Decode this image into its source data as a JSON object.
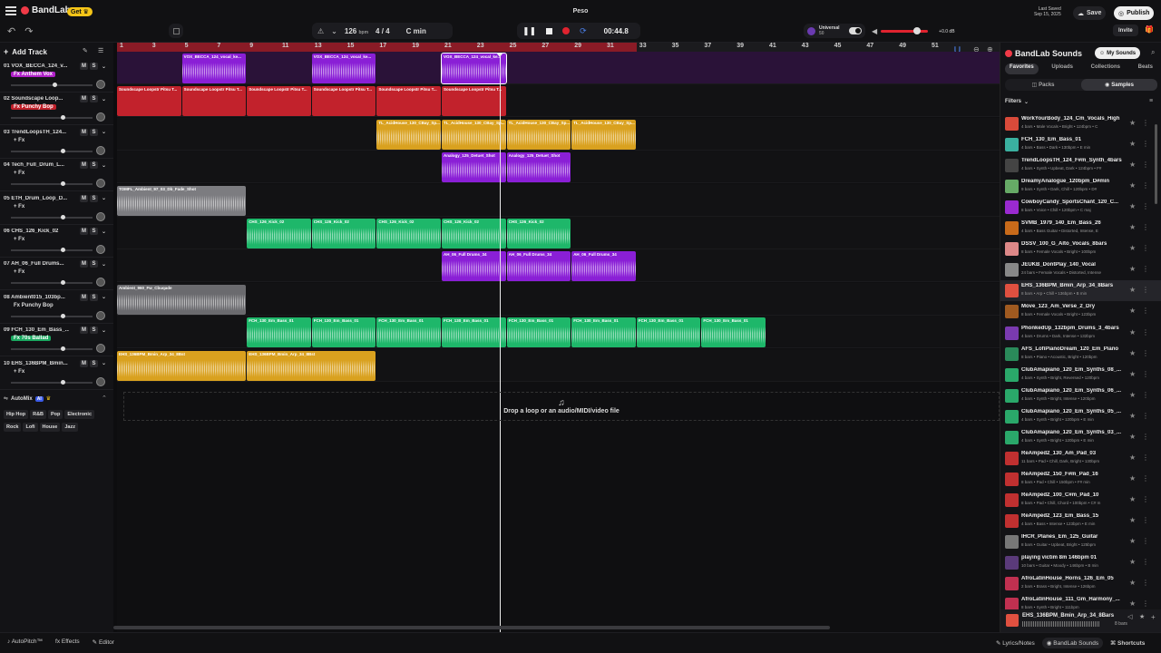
{
  "app": {
    "logo": "BandLab",
    "get_badge": "Get",
    "project_title": "Peso",
    "last_saved": "Last Saved",
    "last_saved_date": "Sep 15, 2025",
    "save": "Save",
    "publish": "Publish",
    "invite": "Invite"
  },
  "transport": {
    "bpm": "126",
    "bpm_unit": "bpm",
    "time_sig": "4 / 4",
    "key": "C min",
    "time": "00:44.8"
  },
  "master": {
    "preset": "Universal",
    "preset_sub": "50",
    "db": "+0.0 dB"
  },
  "ruler": {
    "marks": [
      "1",
      "3",
      "5",
      "7",
      "9",
      "11",
      "13",
      "15",
      "17",
      "19",
      "21",
      "23",
      "25",
      "27",
      "29",
      "31",
      "33",
      "35",
      "37",
      "39",
      "41",
      "43",
      "45",
      "47",
      "49",
      "51"
    ]
  },
  "add_track": "Add Track",
  "tracks": [
    {
      "num": "01",
      "name": "VOX_BECCA_124_v...",
      "fx": "Fx Anthem Vox",
      "fx_color": "#b020c8"
    },
    {
      "num": "02",
      "name": "Soundscape Loop...",
      "fx": "Fx Punchy Bop",
      "fx_color": "#c0202a"
    },
    {
      "num": "03",
      "name": "TrendLoopsTH_124...",
      "fx": "+ Fx",
      "fx_color": ""
    },
    {
      "num": "04",
      "name": "Tech_Full_Drum_L...",
      "fx": "+ Fx",
      "fx_color": ""
    },
    {
      "num": "05",
      "name": "ETH_Drum_Loop_D...",
      "fx": "+ Fx",
      "fx_color": ""
    },
    {
      "num": "06",
      "name": "CHS_126_Kick_02",
      "fx": "+ Fx",
      "fx_color": ""
    },
    {
      "num": "07",
      "name": "AH_06_Full Drums...",
      "fx": "+ Fx",
      "fx_color": ""
    },
    {
      "num": "08",
      "name": "Ambient015_103bp...",
      "fx": "Fx Punchy Bop",
      "fx_color": ""
    },
    {
      "num": "09",
      "name": "FCH_130_Em_Bass_...",
      "fx": "Fx 70s Ballad",
      "fx_color": "#1aa860"
    },
    {
      "num": "10",
      "name": "EHS_136BPM_Bmin...",
      "fx": "+ Fx",
      "fx_color": ""
    }
  ],
  "clips": {
    "t1": "VOX_BECCA_124_vocal_ke...",
    "t2": "Soundscape Loopstr Pitsu T...",
    "t3": "TL_AcidHouse_130_CBay_Sp...",
    "t4": "Analogy_125_Detuet_Shot",
    "t5": "TOMFL_Ambient_97_03_Db_Fade_Shot",
    "t6": "CHS_126_Kick_02",
    "t7": "AH_06_Full Drums_34",
    "t8": "Ambient_960_Fw_Cbuqade",
    "t9": "FCH_130_Em_Bass_01",
    "t10": "EHS_136BPM_Bmin_Arp_34_8Bst"
  },
  "automix": {
    "label": "AutoMix",
    "badge": "AI",
    "genres": [
      "Hip Hop",
      "R&B",
      "Pop",
      "Electronic",
      "Rock",
      "Lofi",
      "House",
      "Jazz"
    ]
  },
  "dropzone": "Drop a loop or an audio/MIDI/video file",
  "panel": {
    "title": "BandLab Sounds",
    "my_sounds": "My Sounds",
    "tabs": [
      "Favorites",
      "Uploads",
      "Collections",
      "Beats"
    ],
    "subtabs": [
      "Packs",
      "Samples"
    ],
    "filters": "Filters",
    "samples": [
      {
        "title": "WorkYourBody_124_Cm_Vocals_High",
        "meta": "4 bars • Male Vocals • Bright • 124bpm • C",
        "color": "#d94a3a"
      },
      {
        "title": "FCH_130_Em_Bass_01",
        "meta": "4 bars • Bass • Dark • 130bpm • E min",
        "color": "#3ab0a0"
      },
      {
        "title": "TrendLoopsTH_124_F#m_Synth_4bars",
        "meta": "4 bars • Synth • Upbeat, Dark • 124bpm • F#",
        "color": "#444"
      },
      {
        "title": "DreamyAnalogue_120bpm_D#min",
        "meta": "9 bars • Synth • Dark, Chill • 120bpm • D#",
        "color": "#6a6"
      },
      {
        "title": "CowboyCandy_SportsChant_120_C...",
        "meta": "8 bars • Voice • Chill • 120bpm • C maj",
        "color": "#9a2ad0"
      },
      {
        "title": "SVMB_1979_140_Em_Bass_26",
        "meta": "4 bars • Bass Guitar • Distorted, Intense, E",
        "color": "#c86a1a"
      },
      {
        "title": "DSSV_100_G_Alto_Vocals_8bars",
        "meta": "8 bars • Female Vocals • Bright • 100bpm",
        "color": "#d88"
      },
      {
        "title": "JEUKB_DontPlay_140_Vocal",
        "meta": "24 bars • Female Vocals • Distorted, Intense",
        "color": "#888"
      },
      {
        "title": "EHS_136BPM_Bmin_Arp_34_8Bars",
        "meta": "8 bars • Arp • Chill • 136bpm • B min",
        "color": "#e05040"
      },
      {
        "title": "Move_123_Am_Verse_2_Dry",
        "meta": "8 bars • Female Vocals • Bright • 123bpm",
        "color": "#a05a20"
      },
      {
        "title": "PhonkedUp_132bpm_Drums_3_4bars",
        "meta": "4 bars • Drums • Dark, Intense • 132bpm",
        "color": "#7a3ab0"
      },
      {
        "title": "AFS_LofiPianoDream_120_Em_Piano",
        "meta": "8 bars • Piano • Acoustic, Bright • 120bpm",
        "color": "#2a8a5a"
      },
      {
        "title": "ClubAmapiano_120_Em_Synths_08_...",
        "meta": "4 bars • Synth • Bright, Reversed • 120bpm",
        "color": "#2aa86a"
      },
      {
        "title": "ClubAmapiano_120_Em_Synths_06_...",
        "meta": "4 bars • Synth • Bright, Intense • 120bpm",
        "color": "#2aa86a"
      },
      {
        "title": "ClubAmapiano_120_Em_Synths_05_...",
        "meta": "4 bars • Synth • Bright • 120bpm • E min",
        "color": "#2aa86a"
      },
      {
        "title": "ClubAmapiano_120_Em_Synths_03_...",
        "meta": "4 bars • Synth • Bright • 120bpm • E min",
        "color": "#2aa86a"
      },
      {
        "title": "ReAmped2_130_Am_Pad_03",
        "meta": "11 bars • Pad • Chill, Dark, Bright • 130bpm",
        "color": "#c03030"
      },
      {
        "title": "ReAmped2_150_F#m_Pad_16",
        "meta": "8 bars • Pad • Chill • 150bpm • F# min",
        "color": "#c03030"
      },
      {
        "title": "ReAmped2_100_C#m_Pad_10",
        "meta": "8 bars • Pad • Chill, Chord • 100bpm • C# m",
        "color": "#c03030"
      },
      {
        "title": "ReAmped2_123_Em_Bass_15",
        "meta": "4 bars • Bass • Intense • 123bpm • E min",
        "color": "#c03030"
      },
      {
        "title": "IHCR_Planes_Em_125_Guitar",
        "meta": "8 bars • Guitar • Upbeat, Bright • 125bpm",
        "color": "#777"
      },
      {
        "title": "playing victim 8m 146bpm 01",
        "meta": "10 bars • Guitar • Moody • 146bpm • B min",
        "color": "#5a3a7a"
      },
      {
        "title": "AfroLatinHouse_Horns_126_Em_05",
        "meta": "2 bars • Brass • Bright, Intense • 126bpm",
        "color": "#c03050"
      },
      {
        "title": "AfroLatinHouse_111_Gm_Harmony_...",
        "meta": "8 bars • Synth • Bright • 111bpm",
        "color": "#c03050"
      }
    ],
    "now_playing": {
      "title": "EHS_136BPM_Bmin_Arp_34_8Bars",
      "meta": "8 bars"
    }
  },
  "bottom": {
    "autopitch": "AutoPitch™",
    "effects": "Effects",
    "editor": "Editor",
    "lyrics": "Lyrics/Notes",
    "sounds": "BandLab Sounds",
    "shortcuts": "Shortcuts"
  }
}
